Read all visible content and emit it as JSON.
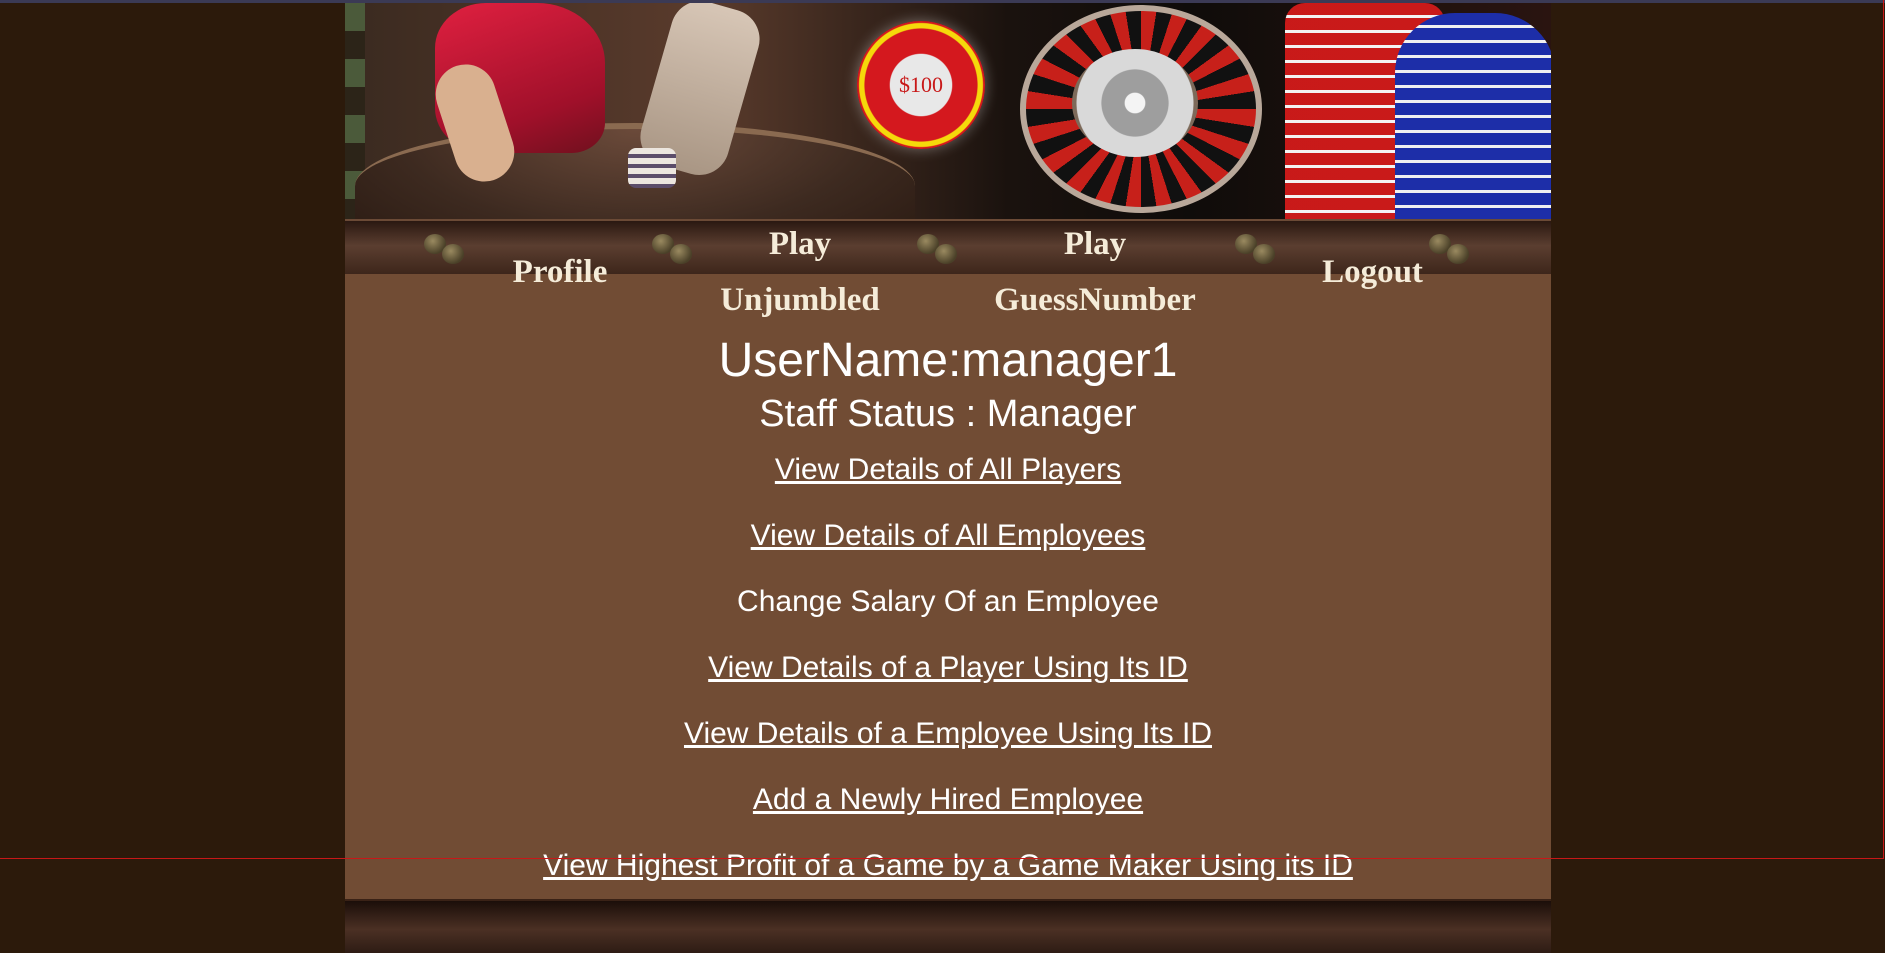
{
  "banner": {
    "chip_text": "$100"
  },
  "nav": {
    "items": [
      {
        "line1": "Profile",
        "line2": ""
      },
      {
        "line1": "Play",
        "line2": "Unjumbled"
      },
      {
        "line1": "Play",
        "line2": "GuessNumber"
      },
      {
        "line1": "Logout",
        "line2": ""
      }
    ]
  },
  "user": {
    "username_text": "UserName:manager1",
    "status_text": "Staff Status : Manager"
  },
  "menu": {
    "items": [
      {
        "label": "View Details of All Players",
        "link": true
      },
      {
        "label": "View Details of All Employees",
        "link": true
      },
      {
        "label": "Change Salary Of an Employee",
        "link": false
      },
      {
        "label": "View Details of a Player Using Its ID",
        "link": true
      },
      {
        "label": "View Details of a Employee Using Its ID",
        "link": true
      },
      {
        "label": "Add a Newly Hired Employee",
        "link": true
      },
      {
        "label": "View Highest Profit of a Game by a Game Maker Using its ID",
        "link": true
      }
    ]
  },
  "colors": {
    "page_background": "#2c1a0b",
    "content_background": "#714c34",
    "text": "#ffffff",
    "nav_text": "#f5ecd9"
  }
}
